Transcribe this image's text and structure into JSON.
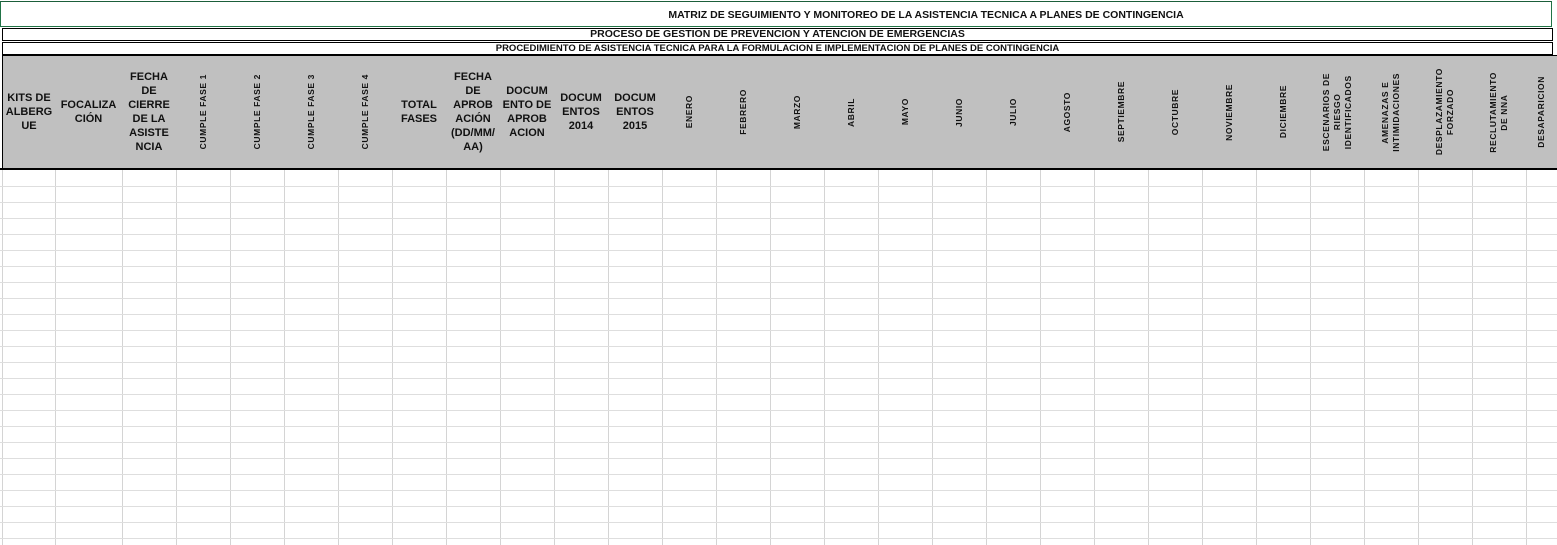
{
  "sheet": {
    "title": "MATRIZ DE SEGUIMIENTO Y MONITOREO DE LA ASISTENCIA TECNICA A PLANES DE CONTINGENCIA",
    "process": "PROCESO DE GESTION DE PREVENCION Y ATENCION DE EMERGENCIAS",
    "procedure": "PROCEDIMIENTO DE ASISTENCIA TECNICA PARA LA FORMULACION E IMPLEMENTACION DE PLANES DE CONTINGENCIA"
  },
  "columns": [
    {
      "label": "KITS DE ALBERG UE",
      "orientation": "horizontal"
    },
    {
      "label": "FOCALIZA CIÓN",
      "orientation": "horizontal"
    },
    {
      "label": "FECHA DE CIERRE DE LA ASISTE NCIA",
      "orientation": "horizontal"
    },
    {
      "label": "CUMPLE FASE 1",
      "orientation": "vertical"
    },
    {
      "label": "CUMPLE FASE 2",
      "orientation": "vertical"
    },
    {
      "label": "CUMPLE FASE 3",
      "orientation": "vertical"
    },
    {
      "label": "CUMPLE FASE 4",
      "orientation": "vertical"
    },
    {
      "label": "TOTAL FASES",
      "orientation": "horizontal"
    },
    {
      "label": "FECHA DE APROB ACIÓN (DD/MM/ AA)",
      "orientation": "horizontal"
    },
    {
      "label": "DOCUM ENTO DE APROB ACION",
      "orientation": "horizontal"
    },
    {
      "label": "DOCUM ENTOS 2014",
      "orientation": "horizontal"
    },
    {
      "label": "DOCUM ENTOS 2015",
      "orientation": "horizontal"
    },
    {
      "label": "ENERO",
      "orientation": "vertical"
    },
    {
      "label": "FEBRERO",
      "orientation": "vertical"
    },
    {
      "label": "MARZO",
      "orientation": "vertical"
    },
    {
      "label": "ABRIL",
      "orientation": "vertical"
    },
    {
      "label": "MAYO",
      "orientation": "vertical"
    },
    {
      "label": "JUNIO",
      "orientation": "vertical"
    },
    {
      "label": "JULIO",
      "orientation": "vertical"
    },
    {
      "label": "AGOSTO",
      "orientation": "vertical"
    },
    {
      "label": "SEPTIEMBRE",
      "orientation": "vertical"
    },
    {
      "label": "OCTUBRE",
      "orientation": "vertical"
    },
    {
      "label": "NOVIEMBRE",
      "orientation": "vertical"
    },
    {
      "label": "DICIEMBRE",
      "orientation": "vertical"
    },
    {
      "label": "ESCENARIOS DE\nRIESGO\nIDENTIFICADOS",
      "orientation": "vertical"
    },
    {
      "label": "AMENAZAS E\nINTIMIDACIONES",
      "orientation": "vertical"
    },
    {
      "label": "DESPLAZAMIENTO\nFORZADO",
      "orientation": "vertical"
    },
    {
      "label": "RECLUTAMIENTO\nDE NNA",
      "orientation": "vertical"
    },
    {
      "label": "DESAPARICION",
      "orientation": "vertical"
    }
  ],
  "colors": {
    "header_fill": "#c0c0c0",
    "grid_line": "#d4d4d4",
    "title_border": "#217346"
  }
}
